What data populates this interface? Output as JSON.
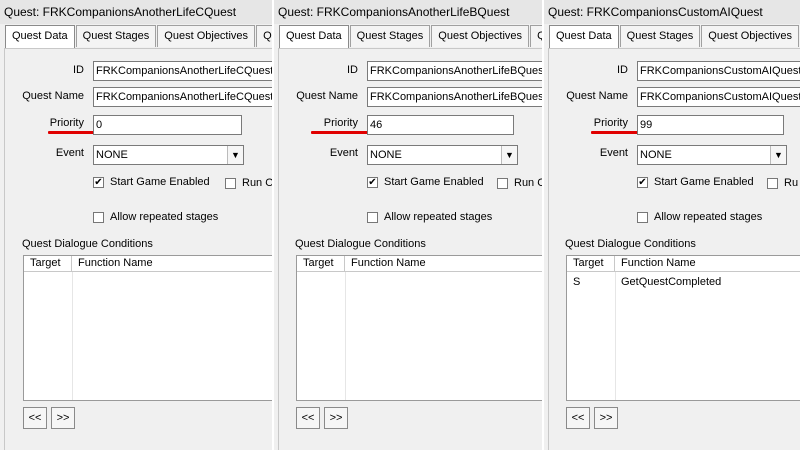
{
  "panels": [
    {
      "title": "Quest: FRKCompanionsAnotherLifeCQuest",
      "tabs": [
        "Quest Data",
        "Quest Stages",
        "Quest Objectives",
        "Qu"
      ],
      "id_label": "ID",
      "id_value": "FRKCompanionsAnotherLifeCQuest",
      "name_label": "Quest Name",
      "name_value": "FRKCompanionsAnotherLifeCQuest",
      "priority_label": "Priority",
      "priority_value": "0",
      "event_label": "Event",
      "event_value": "NONE",
      "start_game_label": "Start Game Enabled",
      "start_game_checked": true,
      "run_label": "Run O",
      "repeat_label": "Allow repeated stages",
      "repeat_checked": false,
      "conditions_label": "Quest Dialogue Conditions",
      "col_target": "Target",
      "col_function": "Function Name",
      "row_target": "",
      "row_function": "",
      "prev_btn": "<<",
      "next_btn": ">>"
    },
    {
      "title": "Quest: FRKCompanionsAnotherLifeBQuest",
      "tabs": [
        "Quest Data",
        "Quest Stages",
        "Quest Objectives",
        "Qu"
      ],
      "id_label": "ID",
      "id_value": "FRKCompanionsAnotherLifeBQuest",
      "name_label": "Quest Name",
      "name_value": "FRKCompanionsAnotherLifeBQuest",
      "priority_label": "Priority",
      "priority_value": "46",
      "event_label": "Event",
      "event_value": "NONE",
      "start_game_label": "Start Game Enabled",
      "start_game_checked": true,
      "run_label": "Run C",
      "repeat_label": "Allow repeated stages",
      "repeat_checked": false,
      "conditions_label": "Quest Dialogue Conditions",
      "col_target": "Target",
      "col_function": "Function Name",
      "row_target": "",
      "row_function": "",
      "prev_btn": "<<",
      "next_btn": ">>"
    },
    {
      "title": "Quest: FRKCompanionsCustomAIQuest",
      "tabs": [
        "Quest Data",
        "Quest Stages",
        "Quest Objectives",
        "Q"
      ],
      "id_label": "ID",
      "id_value": "FRKCompanionsCustomAIQuest",
      "name_label": "Quest Name",
      "name_value": "FRKCompanionsCustomAIQuest",
      "priority_label": "Priority",
      "priority_value": "99",
      "event_label": "Event",
      "event_value": "NONE",
      "start_game_label": "Start Game Enabled",
      "start_game_checked": true,
      "run_label": "Ru",
      "repeat_label": "Allow repeated stages",
      "repeat_checked": false,
      "conditions_label": "Quest Dialogue Conditions",
      "col_target": "Target",
      "col_function": "Function Name",
      "row_target": "S",
      "row_function": "GetQuestCompleted",
      "prev_btn": "<<",
      "next_btn": ">>"
    }
  ],
  "icons": {
    "dropdown": "chevron-down-icon",
    "checkbox_checked": "checkmark-icon"
  },
  "colors": {
    "highlight_underline": "#e00000"
  },
  "glyphs": {
    "check": "✔",
    "arrow_down": "▼"
  }
}
